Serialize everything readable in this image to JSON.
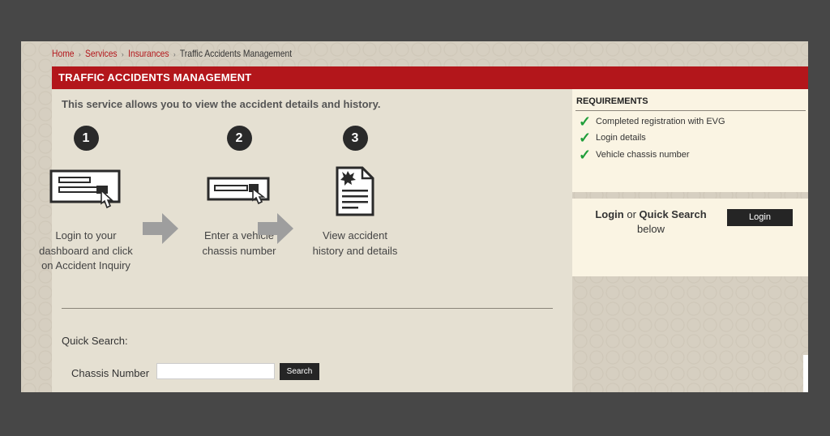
{
  "breadcrumb": {
    "home": "Home",
    "services": "Services",
    "insurances": "Insurances",
    "current": "Traffic Accidents Management",
    "separator": "›"
  },
  "header": {
    "title": "TRAFFIC ACCIDENTS MANAGEMENT"
  },
  "intro": "This service allows you to view the accident details and history.",
  "steps": [
    {
      "number": "1",
      "icon": "dashboard-click-icon",
      "caption": "Login to your dashboard and click on Accident Inquiry"
    },
    {
      "number": "2",
      "icon": "chassis-entry-icon",
      "caption": "Enter a vehicle chassis number"
    },
    {
      "number": "3",
      "icon": "document-icon",
      "caption": "View accident history and details"
    }
  ],
  "quick_search": {
    "label": "Quick Search:",
    "chassis_label": "Chassis Number",
    "chassis_value": "",
    "search_button": "Search"
  },
  "requirements": {
    "title": "REQUIREMENTS",
    "items": [
      "Completed registration with EVG",
      "Login details",
      "Vehicle chassis number"
    ]
  },
  "login_panel": {
    "login_word": "Login",
    "or_word": "or",
    "quick_search_word": "Quick Search",
    "below_word": "below",
    "button": "Login"
  },
  "colors": {
    "background": "#474747",
    "page": "#d6cfc1",
    "header": "#b3161b",
    "panel": "#faf4e3",
    "check": "#1f9e3a",
    "button": "#252525"
  }
}
